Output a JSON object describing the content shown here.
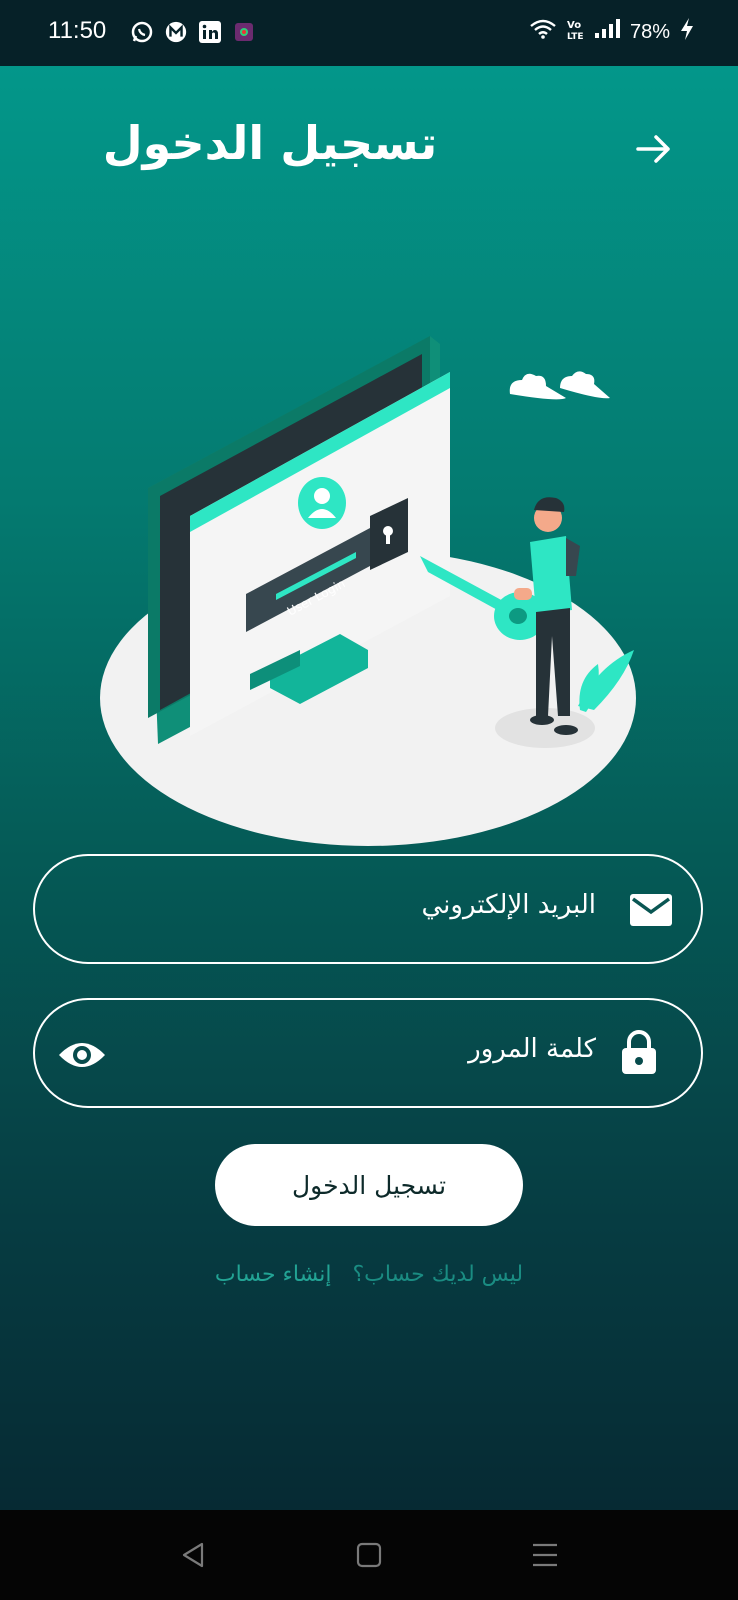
{
  "status_bar": {
    "time": "11:50",
    "battery": "78%",
    "left_icons": [
      "whatsapp-icon",
      "threads-icon",
      "linkedin-icon",
      "app-icon"
    ],
    "right_icons": [
      "wifi-icon",
      "volte-icon",
      "signal-icon",
      "battery-charging-icon"
    ]
  },
  "header": {
    "title": "تسجيل الدخول",
    "back_icon": "arrow-right-icon"
  },
  "illustration": {
    "screen_label": "User Login",
    "description_icon": "computer-login-illustration"
  },
  "form": {
    "email_placeholder": "البريد الإلكتروني",
    "email_icon": "mail-icon",
    "password_placeholder": "كلمة المرور",
    "password_icon": "lock-icon",
    "visibility_icon": "eye-icon",
    "login_label": "تسجيل الدخول"
  },
  "signup": {
    "prompt": "ليس لديك حساب؟",
    "link": "إنشاء حساب"
  },
  "nav_bar": {
    "back": "triangle-back-icon",
    "home": "square-home-icon",
    "menu": "menu-lines-icon"
  },
  "colors": {
    "accent": "#03978a",
    "accent_light": "#2ee6c4",
    "status_bar": "#062128",
    "link": "#22a394"
  }
}
